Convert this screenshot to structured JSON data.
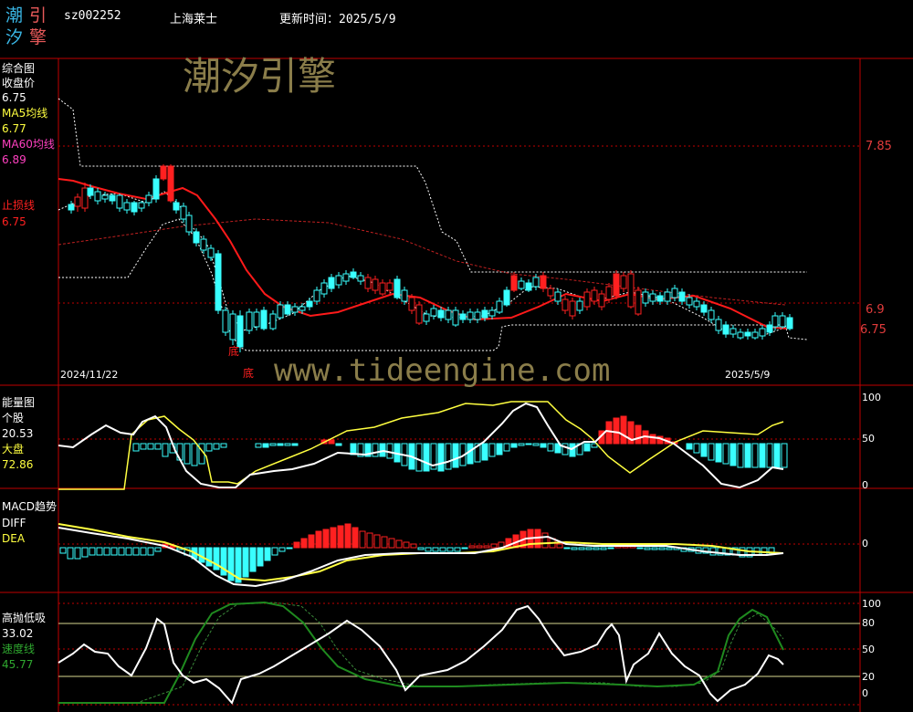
{
  "logo": {
    "chars": [
      "潮",
      "引",
      "汐",
      "擎"
    ]
  },
  "header": {
    "code": "sz002252",
    "name": "上海莱士",
    "update_label": "更新时间：",
    "update_date": "2025/5/9"
  },
  "panel1": {
    "title": "综合图",
    "close_label": "收盘价",
    "close_value": "6.75",
    "ma5_label": "MA5均线",
    "ma5_value": "6.77",
    "ma60_label": "MA60均线",
    "ma60_value": "6.89",
    "stop_label": "止损线",
    "stop_value": "6.75",
    "watermark": "潮汐引擎",
    "axis_right": [
      "7.85",
      "6.9",
      "6.75"
    ],
    "date_start": "2024/11/22",
    "date_end": "2025/5/9",
    "bottom_marks": [
      "底",
      "底"
    ]
  },
  "watermark_url": "www.tideengine.com",
  "panel2": {
    "title": "能量图",
    "stock_label": "个股",
    "stock_value": "20.53",
    "market_label": "大盘",
    "market_value": "72.86",
    "axis_right": [
      "100",
      "50",
      "0"
    ]
  },
  "panel3": {
    "title": "MACD趋势",
    "diff_label": "DIFF",
    "dea_label": "DEA",
    "axis_right": [
      "0"
    ]
  },
  "panel4": {
    "title": "高抛低吸",
    "value1": "33.02",
    "speed_label": "速度线",
    "speed_value": "45.77",
    "axis_right": [
      "100",
      "80",
      "50",
      "20",
      "0"
    ]
  },
  "colors": {
    "background": "#000000",
    "grid_red": "#c00000",
    "axis_red": "#e23c3c",
    "up_red": "#ff2020",
    "down_cyan": "#39ffff",
    "ma5_white": "#ffffff",
    "ma60_red": "#e01010",
    "yellow": "#ffff40",
    "magenta": "#ff40c0",
    "green": "#1f8a1f",
    "watermark": "#8a7d4a"
  }
}
